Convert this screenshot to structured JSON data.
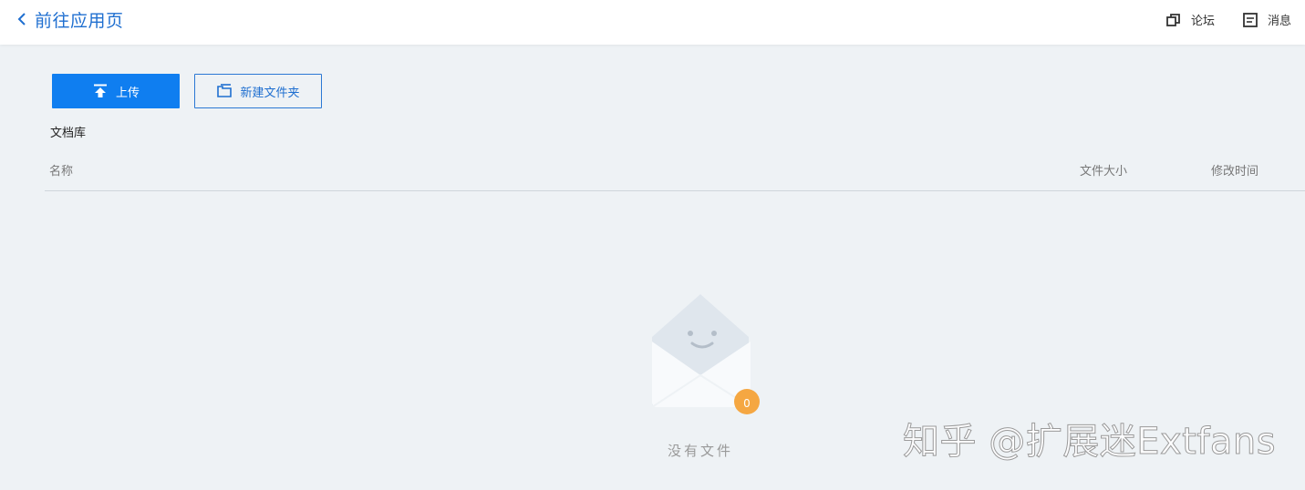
{
  "header": {
    "back_label": "前往应用页",
    "nav": [
      {
        "label": "论坛",
        "icon": "external-window-icon"
      },
      {
        "label": "消息",
        "icon": "message-icon"
      }
    ]
  },
  "toolbar": {
    "upload_label": "上传",
    "new_folder_label": "新建文件夹"
  },
  "section_title": "文档库",
  "table": {
    "columns": [
      "名称",
      "文件大小",
      "修改时间"
    ]
  },
  "empty_state": {
    "text": "没有文件",
    "badge_count": "0"
  },
  "watermark": "知乎 @扩展迷Extfans",
  "colors": {
    "primary": "#0f7ef0",
    "link": "#1f6fd0",
    "background": "#eef2f5",
    "badge": "#f5a742"
  }
}
